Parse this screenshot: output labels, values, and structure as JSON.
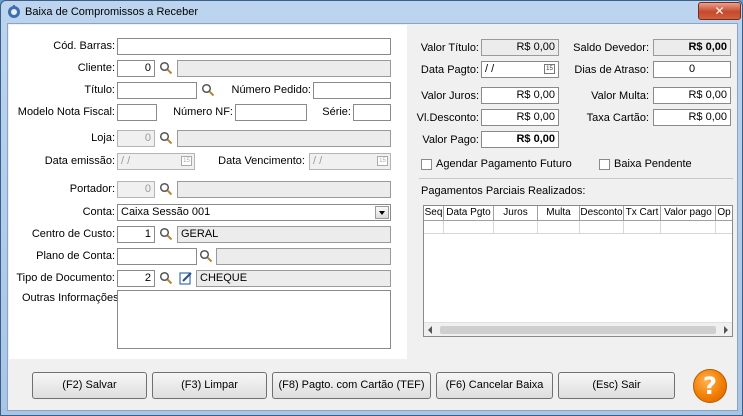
{
  "window": {
    "title": "Baixa de Compromissos a Receber",
    "close_label": "✕"
  },
  "form": {
    "cod_barras": {
      "label": "Cód. Barras:",
      "value": ""
    },
    "cliente": {
      "label": "Cliente:",
      "code": "0",
      "name": ""
    },
    "titulo": {
      "label": "Título:",
      "value": ""
    },
    "numero_pedido": {
      "label": "Número Pedido:",
      "value": ""
    },
    "modelo_nf": {
      "label": "Modelo Nota Fiscal:",
      "value": ""
    },
    "numero_nf": {
      "label": "Número NF:",
      "value": ""
    },
    "serie": {
      "label": "Série:",
      "value": ""
    },
    "loja": {
      "label": "Loja:",
      "code": "0",
      "name": ""
    },
    "data_emissao": {
      "label": "Data emissão:",
      "value": "/ /"
    },
    "data_vencimento": {
      "label": "Data Vencimento:",
      "value": "/ /"
    },
    "portador": {
      "label": "Portador:",
      "code": "0",
      "name": ""
    },
    "conta": {
      "label": "Conta:",
      "value": "Caixa Sessão 001"
    },
    "centro_custo": {
      "label": "Centro de Custo:",
      "code": "1",
      "name": "GERAL"
    },
    "plano_conta": {
      "label": "Plano de Conta:",
      "code": "",
      "name": ""
    },
    "tipo_documento": {
      "label": "Tipo de Documento:",
      "code": "2",
      "name": "CHEQUE"
    },
    "outras_info": {
      "label": "Outras Informações:",
      "value": ""
    }
  },
  "values": {
    "valor_titulo": {
      "label": "Valor Título:",
      "value": "R$ 0,00"
    },
    "saldo_devedor": {
      "label": "Saldo Devedor:",
      "value": "R$ 0,00"
    },
    "data_pagto": {
      "label": "Data Pagto:",
      "value": "/ /"
    },
    "dias_atraso": {
      "label": "Dias de Atraso:",
      "value": "0"
    },
    "valor_juros": {
      "label": "Valor Juros:",
      "value": "R$ 0,00"
    },
    "valor_multa": {
      "label": "Valor Multa:",
      "value": "R$ 0,00"
    },
    "vl_desconto": {
      "label": "Vl.Desconto:",
      "value": "R$ 0,00"
    },
    "taxa_cartao": {
      "label": "Taxa Cartão:",
      "value": "R$ 0,00"
    },
    "valor_pago": {
      "label": "Valor Pago:",
      "value": "R$ 0,00"
    },
    "agendar_label": "Agendar Pagamento Futuro",
    "baixa_pendente_label": "Baixa Pendente"
  },
  "pagamentos": {
    "title": "Pagamentos Parciais Realizados:",
    "columns": [
      "Seq",
      "Data Pgto",
      "Juros",
      "Multa",
      "Desconto",
      "Tx Cart",
      "Valor pago",
      "Op"
    ]
  },
  "buttons": {
    "salvar": "(F2) Salvar",
    "limpar": "(F3) Limpar",
    "pagto_cartao": "(F8) Pagto. com Cartão (TEF)",
    "cancelar_baixa": "(F6) Cancelar Baixa",
    "sair": "(Esc) Sair",
    "help": "?"
  },
  "colors": {
    "accent_help": "#f07a00",
    "window_frame": "#a9c5e6"
  }
}
